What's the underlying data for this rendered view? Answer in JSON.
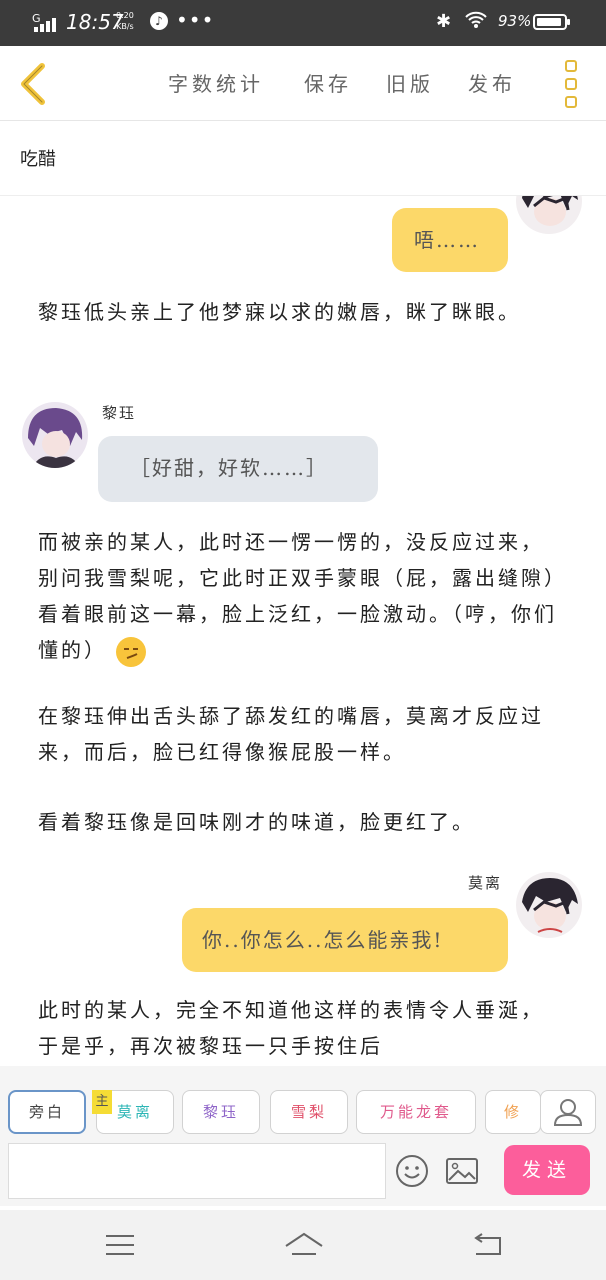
{
  "status_bar": {
    "signal": "G",
    "time": "18:57",
    "net_speed": "0.20",
    "net_unit": "KB/s",
    "notification": "♪",
    "more": "•••",
    "bluetooth": "✱",
    "wifi": "◠",
    "battery": "93%",
    "battery_level": 0.93
  },
  "toolbar": {
    "back_icon": "chevron-left-icon",
    "word_count": "字数统计",
    "save": "保存",
    "old_version": "旧版",
    "publish": "发布",
    "menu_icon": "menu-icon"
  },
  "story": {
    "title": "吃醋"
  },
  "content": {
    "bubble_1": "唔……",
    "para_1": "黎珏低头亲上了他梦寐以求的嫩唇，眯了眯眼。",
    "speaker_2": "黎珏",
    "bubble_2": "［好甜，好软……］",
    "para_2": "而被亲的某人，此时还一愣一愣的，没反应过来，别问我雪梨呢，它此时正双手蒙眼（屁，露出缝隙）看着眼前这一幕，脸上泛红，一脸激动。（哼，你们懂的）",
    "para_3": "在黎珏伸出舌头舔了舔发红的嘴唇，莫离才反应过来，而后，脸已红得像猴屁股一样。",
    "para_4": "看着黎珏像是回味刚才的味道，脸更红了。",
    "speaker_3": "莫离",
    "bubble_3": "你..你怎么..怎么能亲我!",
    "para_5": "此时的某人，完全不知道他这样的表情令人垂涎，于是乎，再次被黎珏一只手按住后"
  },
  "characters": {
    "items": [
      {
        "label": "旁白",
        "color": "#444444"
      },
      {
        "label": "莫离",
        "color": "#2bb5b5"
      },
      {
        "label": "黎珏",
        "color": "#8e64c8"
      },
      {
        "label": "雪梨",
        "color": "#e0506a"
      },
      {
        "label": "万能龙套",
        "color": "#e05a8c"
      },
      {
        "label": "修",
        "color": "#f0a050"
      }
    ],
    "main_badge": "主"
  },
  "composer": {
    "input_value": "",
    "input_placeholder": "",
    "send": "发送"
  }
}
